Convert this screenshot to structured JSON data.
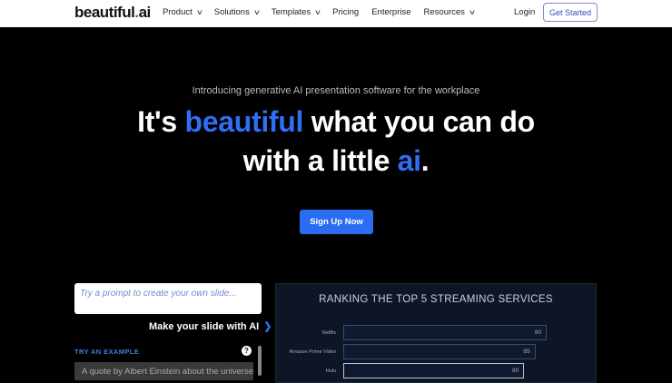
{
  "nav": {
    "logo": "beautiful.ai",
    "logo_main": "beautiful",
    "logo_dot": ".",
    "logo_tail": "ai",
    "items": [
      {
        "label": "Product",
        "dropdown": true
      },
      {
        "label": "Solutions",
        "dropdown": true
      },
      {
        "label": "Templates",
        "dropdown": true
      },
      {
        "label": "Pricing",
        "dropdown": false
      },
      {
        "label": "Enterprise",
        "dropdown": false
      },
      {
        "label": "Resources",
        "dropdown": true
      }
    ],
    "login": "Login",
    "get_started": "Get Started"
  },
  "hero": {
    "intro": "Introducing generative AI presentation software for the workplace",
    "line1_a": "It's ",
    "line1_b": "beautiful",
    "line1_c": " what you can do",
    "line2_a": "with a little ",
    "line2_b": "ai",
    "line2_c": ".",
    "signup": "Sign Up Now"
  },
  "prompt": {
    "placeholder": "Try a prompt to create your own slide...",
    "make": "Make your slide with AI",
    "try_label": "TRY AN EXAMPLE",
    "help": "?",
    "example": "A quote by Albert Einstein about the universe"
  },
  "colors": {
    "accent": "#2a6cf2"
  },
  "chart_data": {
    "type": "bar",
    "orientation": "horizontal",
    "title": "RANKING THE TOP 5 STREAMING SERVICES",
    "categories": [
      "Netflix",
      "Amazon Prime Video",
      "Hulu"
    ],
    "values": [
      90,
      85,
      80
    ],
    "highlight": "Hulu"
  }
}
